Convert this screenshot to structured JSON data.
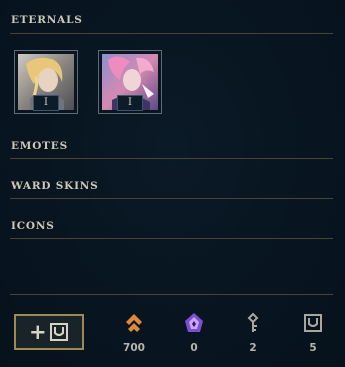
{
  "sections": {
    "eternals": "ETERNALS",
    "emotes": "EMOTES",
    "ward_skins": "WARD SKINS",
    "icons": "ICONS"
  },
  "eternals": [
    {
      "tier": "I"
    },
    {
      "tier": "I"
    }
  ],
  "add_button": {
    "label": "+"
  },
  "currencies": [
    {
      "icon": "orange-essence-icon",
      "value": "700",
      "color": "#e0893a"
    },
    {
      "icon": "mythic-essence-icon",
      "value": "0",
      "color": "#9b6ae0"
    },
    {
      "icon": "key-icon",
      "value": "2",
      "color": "#a9a69c"
    },
    {
      "icon": "chest-icon",
      "value": "5",
      "color": "#a9a69c"
    }
  ],
  "colors": {
    "accent_gold": "#a08a52",
    "divider": "#4a4530",
    "heading": "#cfc8b6"
  }
}
